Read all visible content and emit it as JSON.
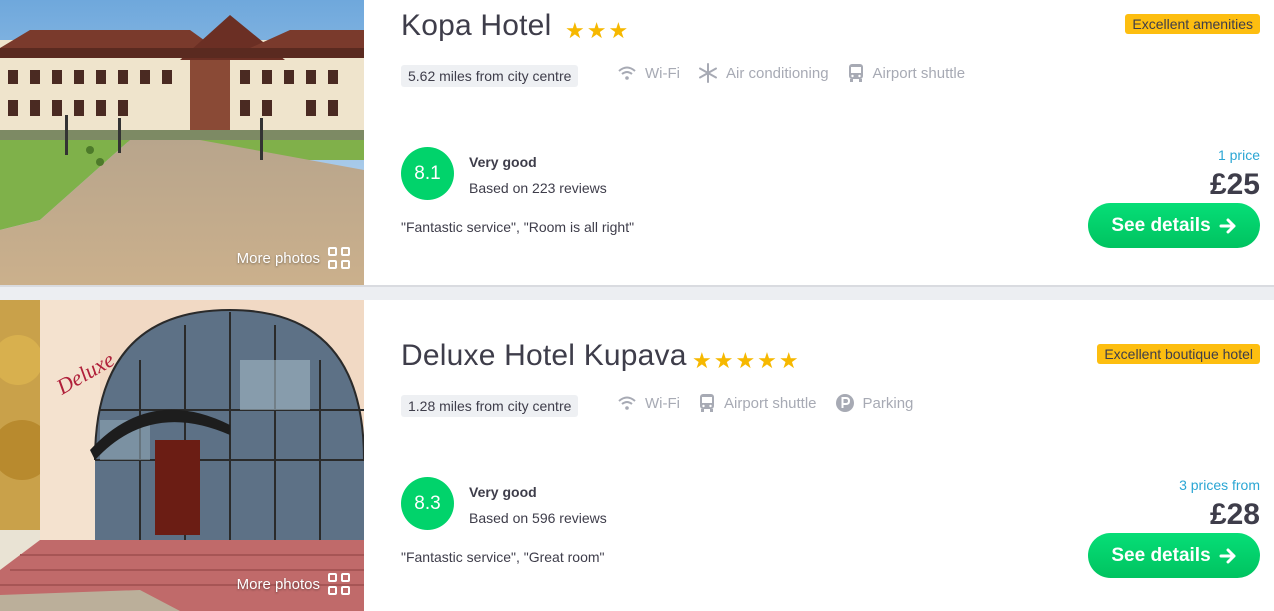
{
  "hotels": [
    {
      "name": "Kopa Hotel",
      "stars": "★★★",
      "badge": "Excellent amenities",
      "distance": "5.62 miles from city centre",
      "amenities": [
        {
          "label": "Wi-Fi",
          "icon": "wifi-icon"
        },
        {
          "label": "Air conditioning",
          "icon": "snowflake-icon"
        },
        {
          "label": "Airport shuttle",
          "icon": "bus-icon"
        }
      ],
      "score": "8.1",
      "rating_label": "Very good",
      "reviews": "Based on 223 reviews",
      "quote": "\"Fantastic service\", \"Room is all right\"",
      "price_count": "1 price",
      "price": "£25",
      "button": "See details",
      "more_photos": "More photos"
    },
    {
      "name": "Deluxe Hotel Kupava",
      "stars": "★★★★★",
      "badge": "Excellent boutique hotel",
      "distance": "1.28 miles from city centre",
      "amenities": [
        {
          "label": "Wi-Fi",
          "icon": "wifi-icon"
        },
        {
          "label": "Airport shuttle",
          "icon": "bus-icon"
        },
        {
          "label": "Parking",
          "icon": "parking-icon"
        }
      ],
      "score": "8.3",
      "rating_label": "Very good",
      "reviews": "Based on 596 reviews",
      "quote": "\"Fantastic service\", \"Great room\"",
      "price_count": "3 prices from",
      "price": "£28",
      "button": "See details",
      "more_photos": "More photos"
    }
  ],
  "colors": {
    "score_green": "#01d36b",
    "badge_yellow": "#fdbe10",
    "star_gold": "#f6b800",
    "price_link_blue": "#2ba6d4",
    "button_green": "#00c360"
  }
}
